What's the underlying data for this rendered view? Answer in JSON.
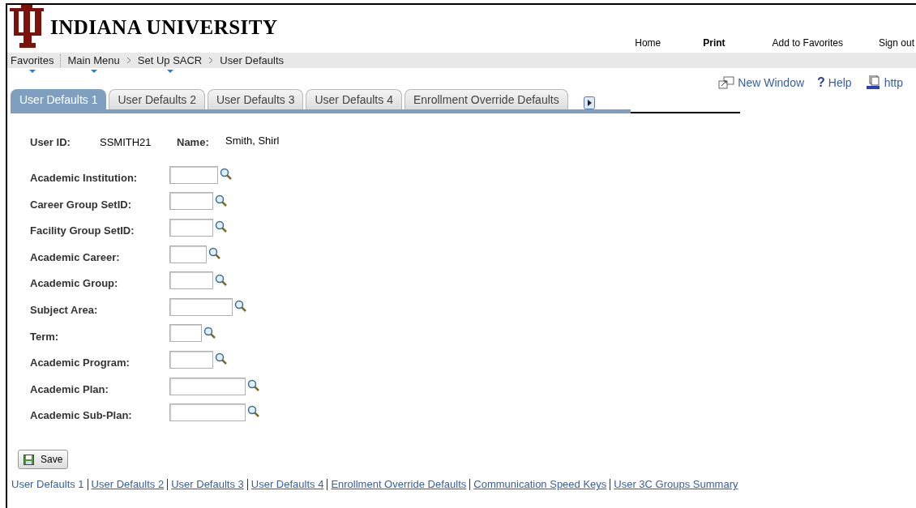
{
  "header": {
    "title": "INDIANA UNIVERSITY",
    "links": [
      {
        "label": "Home",
        "bold": false
      },
      {
        "label": "Print",
        "bold": true
      },
      {
        "label": "Add to Favorites",
        "bold": false
      },
      {
        "label": "Sign out",
        "bold": false
      }
    ]
  },
  "breadcrumb": [
    {
      "label": "Favorites",
      "menu": true
    },
    {
      "label": "Main Menu",
      "menu": true
    },
    {
      "label": "Set Up SACR",
      "menu": true
    },
    {
      "label": "User Defaults",
      "menu": false
    }
  ],
  "page_links": [
    "New Window",
    "Help",
    "http"
  ],
  "help_glyph": "?",
  "tabs": [
    {
      "label": "User Defaults 1",
      "selected": true
    },
    {
      "label": "User Defaults 2",
      "selected": false
    },
    {
      "label": "User Defaults 3",
      "selected": false
    },
    {
      "label": "User Defaults 4",
      "selected": false
    },
    {
      "label": "Enrollment Override Defaults",
      "selected": false
    }
  ],
  "user": {
    "id_label": "User ID:",
    "id": "SSMITH21",
    "name_label": "Name:",
    "name": "Smith, Shirl"
  },
  "fields": [
    {
      "label": "Academic Institution:"
    },
    {
      "label": "Career Group SetID:"
    },
    {
      "label": "Facility Group SetID:"
    },
    {
      "label": "Academic Career:"
    },
    {
      "label": "Academic Group:"
    },
    {
      "label": "Subject Area:"
    },
    {
      "label": "Term:"
    },
    {
      "label": "Academic Program:"
    },
    {
      "label": "Academic Plan:"
    },
    {
      "label": "Academic Sub-Plan:"
    }
  ],
  "save_button": "Save",
  "footer_links": [
    {
      "label": "User Defaults 1",
      "selected": true
    },
    {
      "label": "User Defaults 2",
      "selected": false
    },
    {
      "label": "User Defaults 3",
      "selected": false
    },
    {
      "label": "User Defaults 4",
      "selected": false
    },
    {
      "label": "Enrollment Override Defaults",
      "selected": false
    },
    {
      "label": "Communication Speed Keys",
      "selected": false
    },
    {
      "label": "User 3C Groups Summary",
      "selected": false
    }
  ]
}
